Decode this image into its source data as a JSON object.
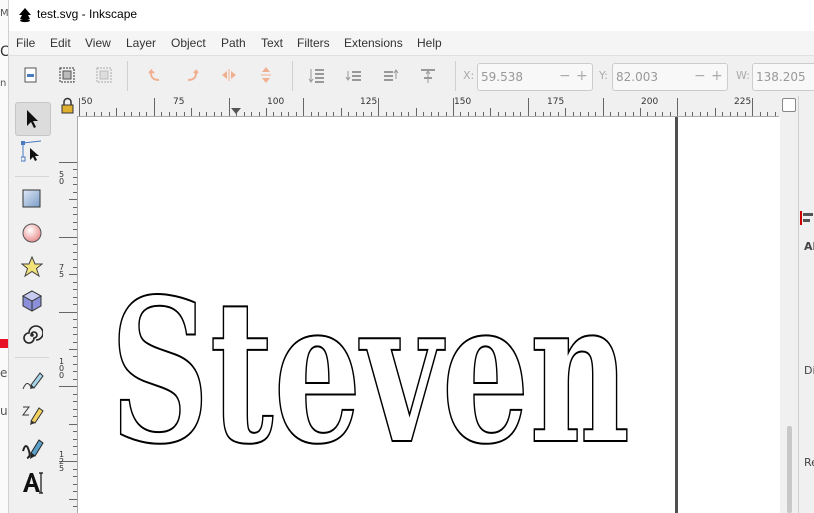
{
  "window": {
    "title": "test.svg - Inkscape"
  },
  "menu": [
    "File",
    "Edit",
    "View",
    "Layer",
    "Object",
    "Path",
    "Text",
    "Filters",
    "Extensions",
    "Help"
  ],
  "background_window": {
    "fragments": [
      "M",
      "C",
      "n",
      "e",
      "u"
    ]
  },
  "controls": {
    "x_label": "X:",
    "x_value": "59.538",
    "y_label": "Y:",
    "y_value": "82.003",
    "w_label": "W:",
    "w_value": "138.205",
    "minus": "−",
    "plus": "+"
  },
  "ruler": {
    "h_labels": [
      "50",
      "75",
      "100",
      "125",
      "150",
      "175",
      "200",
      "225"
    ],
    "v_labels": [
      "50",
      "75",
      "100",
      "125"
    ]
  },
  "canvas": {
    "text": "Steven",
    "page_border_color": "#505050"
  },
  "right_panel": {
    "labels": [
      "Al",
      "Di",
      "Re"
    ]
  },
  "tools": [
    "selector-tool",
    "node-tool",
    "rectangle-tool",
    "ellipse-tool",
    "star-tool",
    "3d-box-tool",
    "spiral-tool",
    "pencil-tool",
    "pen-tool",
    "calligraphy-tool",
    "text-tool"
  ]
}
